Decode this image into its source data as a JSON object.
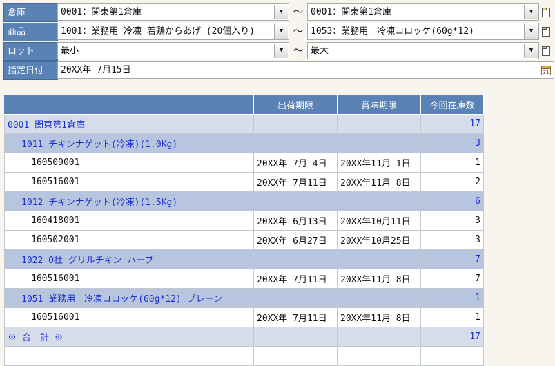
{
  "filters": {
    "warehouse": {
      "label": "倉庫",
      "from": "0001：関東第1倉庫",
      "to": "0001：関東第1倉庫"
    },
    "product": {
      "label": "商品",
      "from": "1001：業務用 冷凍 若鶏からあげ (20個入り)",
      "to": "1053：業務用　冷凍コロッケ(60g*12)"
    },
    "lot": {
      "label": "ロット",
      "from": "最小",
      "to": "最大"
    },
    "date": {
      "label": "指定日付",
      "value": "20XX年 7月15日"
    },
    "range_sep": "～"
  },
  "table": {
    "headers": [
      "",
      "出荷期限",
      "賞味期限",
      "今回在庫数"
    ],
    "rows": [
      {
        "type": "warehouse",
        "name": "0001 関東第1倉庫",
        "ship": "",
        "best": "",
        "qty": "17"
      },
      {
        "type": "product",
        "name": "1011 チキンナゲット(冷凍)(1.0Kg)",
        "ship": "",
        "best": "",
        "qty": "3"
      },
      {
        "type": "lot",
        "name": "160509001",
        "ship": "20XX年 7月 4日",
        "best": "20XX年11月 1日",
        "qty": "1"
      },
      {
        "type": "lot",
        "name": "160516001",
        "ship": "20XX年 7月11日",
        "best": "20XX年11月 8日",
        "qty": "2"
      },
      {
        "type": "product",
        "name": "1012 チキンナゲット(冷凍)(1.5Kg)",
        "ship": "",
        "best": "",
        "qty": "6"
      },
      {
        "type": "lot",
        "name": "160418001",
        "ship": "20XX年 6月13日",
        "best": "20XX年10月11日",
        "qty": "3"
      },
      {
        "type": "lot",
        "name": "160502001",
        "ship": "20XX年 6月27日",
        "best": "20XX年10月25日",
        "qty": "3"
      },
      {
        "type": "product",
        "name": "1022 O社 グリルチキン ハーブ",
        "ship": "",
        "best": "",
        "qty": "7"
      },
      {
        "type": "lot",
        "name": "160516001",
        "ship": "20XX年 7月11日",
        "best": "20XX年11月 8日",
        "qty": "7"
      },
      {
        "type": "product",
        "name": "1051 業務用　冷凍コロッケ(60g*12) プレーン",
        "ship": "",
        "best": "",
        "qty": "1"
      },
      {
        "type": "lot",
        "name": "160516001",
        "ship": "20XX年 7月11日",
        "best": "20XX年11月 8日",
        "qty": "1"
      },
      {
        "type": "total",
        "name": "※ 合　計 ※",
        "ship": "",
        "best": "",
        "qty": "17"
      }
    ]
  }
}
